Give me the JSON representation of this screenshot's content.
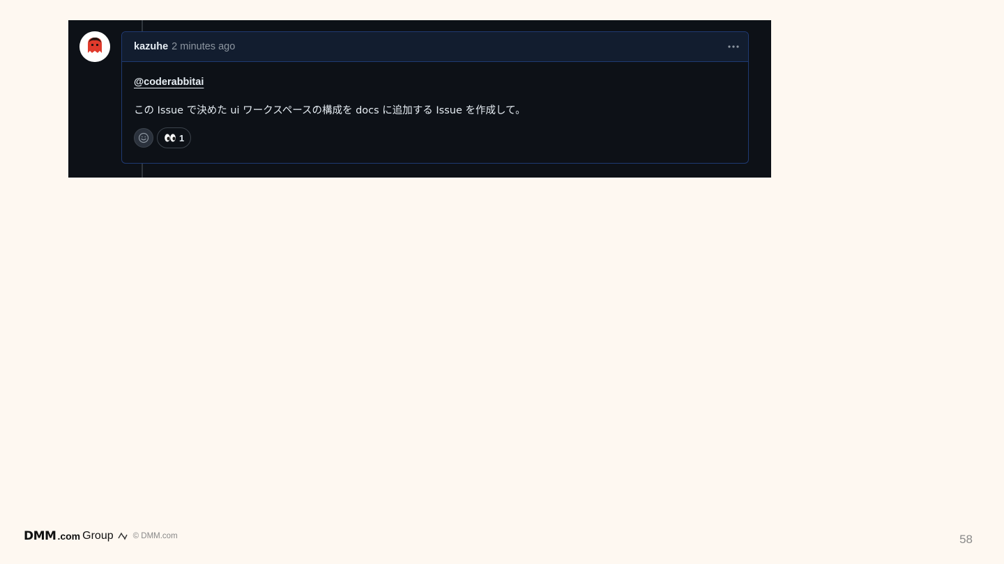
{
  "comment": {
    "author": "kazuhe",
    "timestamp": "2 minutes ago",
    "mention": "@coderabbitai",
    "message": "この Issue で決めた ui ワークスペースの構成を docs に追加する Issue を作成して。",
    "reactions": [
      {
        "emoji": "👀",
        "count": "1"
      }
    ]
  },
  "footer": {
    "brand": "DMM",
    "brand_suffix": ".com",
    "brand_group": "Group",
    "copyright": "© DMM.com"
  },
  "page": {
    "number": "58"
  },
  "colors": {
    "slide_background": "#fef8f1",
    "panel_background": "#0d1117",
    "header_background": "#121d2f",
    "border_accent": "#1f3a73",
    "text_primary": "#e6edf3",
    "text_muted": "#8d96a0"
  }
}
